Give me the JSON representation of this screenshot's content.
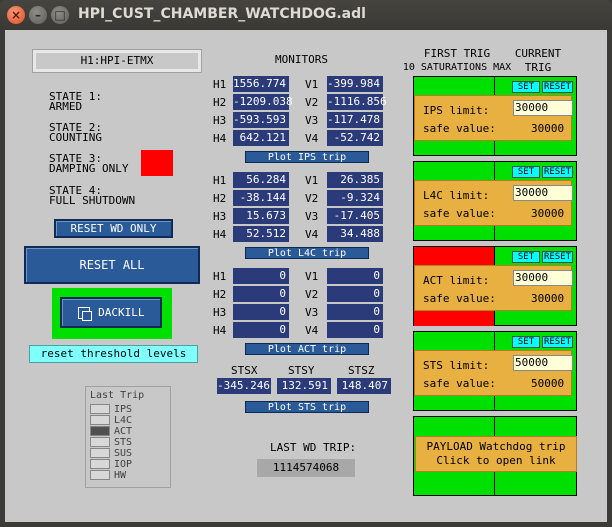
{
  "window": {
    "title": "HPI_CUST_CHAMBER_WATCHDOG.adl"
  },
  "chamber_name": "H1:HPI-ETMX",
  "states": [
    {
      "heading": "STATE 1:",
      "desc": "ARMED"
    },
    {
      "heading": "STATE 2:",
      "desc": "COUNTING"
    },
    {
      "heading": "STATE 3:",
      "desc": "DAMPING ONLY"
    },
    {
      "heading": "STATE 4:",
      "desc": "FULL SHUTDOWN"
    }
  ],
  "colors": {
    "state3_led": "#ff0000",
    "dackill_ring": "#00e000",
    "trip_ok": "#00e000",
    "trip_fault": "#ff0000",
    "panel": "#e8b040"
  },
  "buttons": {
    "reset_wd_only": "RESET WD ONLY",
    "reset_all": "RESET ALL",
    "dackill": "DACKILL",
    "reset_threshold": "reset threshold levels"
  },
  "last_trip": {
    "title": "Last Trip",
    "items": [
      "IPS",
      "L4C",
      "ACT",
      "STS",
      "SUS",
      "IOP",
      "HW"
    ],
    "active": "ACT"
  },
  "monitors": {
    "title": "MONITORS",
    "groups": [
      {
        "h": [
          [
            "H1",
            "1556.774"
          ],
          [
            "H2",
            "-1209.038"
          ],
          [
            "H3",
            "-593.593"
          ],
          [
            "H4",
            "642.121"
          ]
        ],
        "v": [
          [
            "V1",
            "-399.984"
          ],
          [
            "V2",
            "-1116.856"
          ],
          [
            "V3",
            "-117.478"
          ],
          [
            "V4",
            "-52.742"
          ]
        ],
        "plot": "Plot IPS trip"
      },
      {
        "h": [
          [
            "H1",
            "56.284"
          ],
          [
            "H2",
            "-38.144"
          ],
          [
            "H3",
            "15.673"
          ],
          [
            "H4",
            "52.512"
          ]
        ],
        "v": [
          [
            "V1",
            "26.385"
          ],
          [
            "V2",
            "-9.324"
          ],
          [
            "V3",
            "-17.405"
          ],
          [
            "V4",
            "34.488"
          ]
        ],
        "plot": "Plot L4C trip"
      },
      {
        "h": [
          [
            "H1",
            "0"
          ],
          [
            "H2",
            "0"
          ],
          [
            "H3",
            "0"
          ],
          [
            "H4",
            "0"
          ]
        ],
        "v": [
          [
            "V1",
            "0"
          ],
          [
            "V2",
            "0"
          ],
          [
            "V3",
            "0"
          ],
          [
            "V4",
            "0"
          ]
        ],
        "plot": "Plot ACT trip"
      }
    ],
    "sts": {
      "labels": [
        "STSX",
        "STSY",
        "STSZ"
      ],
      "values": [
        "-345.246",
        "132.591",
        "148.407"
      ],
      "plot": "Plot STS trip"
    }
  },
  "last_wd_trip": {
    "title": "LAST WD TRIP:",
    "value": "1114574068"
  },
  "headers": {
    "first_trig": "FIRST TRIG",
    "saturations": "10 SATURATIONS MAX",
    "current": "CURRENT",
    "trig": "TRIG"
  },
  "trips": [
    {
      "limit_label": "IPS limit:",
      "limit": "30000",
      "safe_label": "safe value:",
      "safe": "30000",
      "set": "SET",
      "reset": "RESET",
      "first": "ok"
    },
    {
      "limit_label": "L4C limit:",
      "limit": "30000",
      "safe_label": "safe value:",
      "safe": "30000",
      "set": "SET",
      "reset": "RESET",
      "first": "ok"
    },
    {
      "limit_label": "ACT limit:",
      "limit": "30000",
      "safe_label": "safe value:",
      "safe": "30000",
      "set": "SET",
      "reset": "RESET",
      "first": "fault"
    },
    {
      "limit_label": "STS limit:",
      "limit": "50000",
      "safe_label": "safe value:",
      "safe": "50000",
      "set": "SET",
      "reset": "RESET",
      "first": "ok"
    }
  ],
  "payload": {
    "line1": "PAYLOAD Watchdog trip",
    "line2": "Click to open link"
  }
}
